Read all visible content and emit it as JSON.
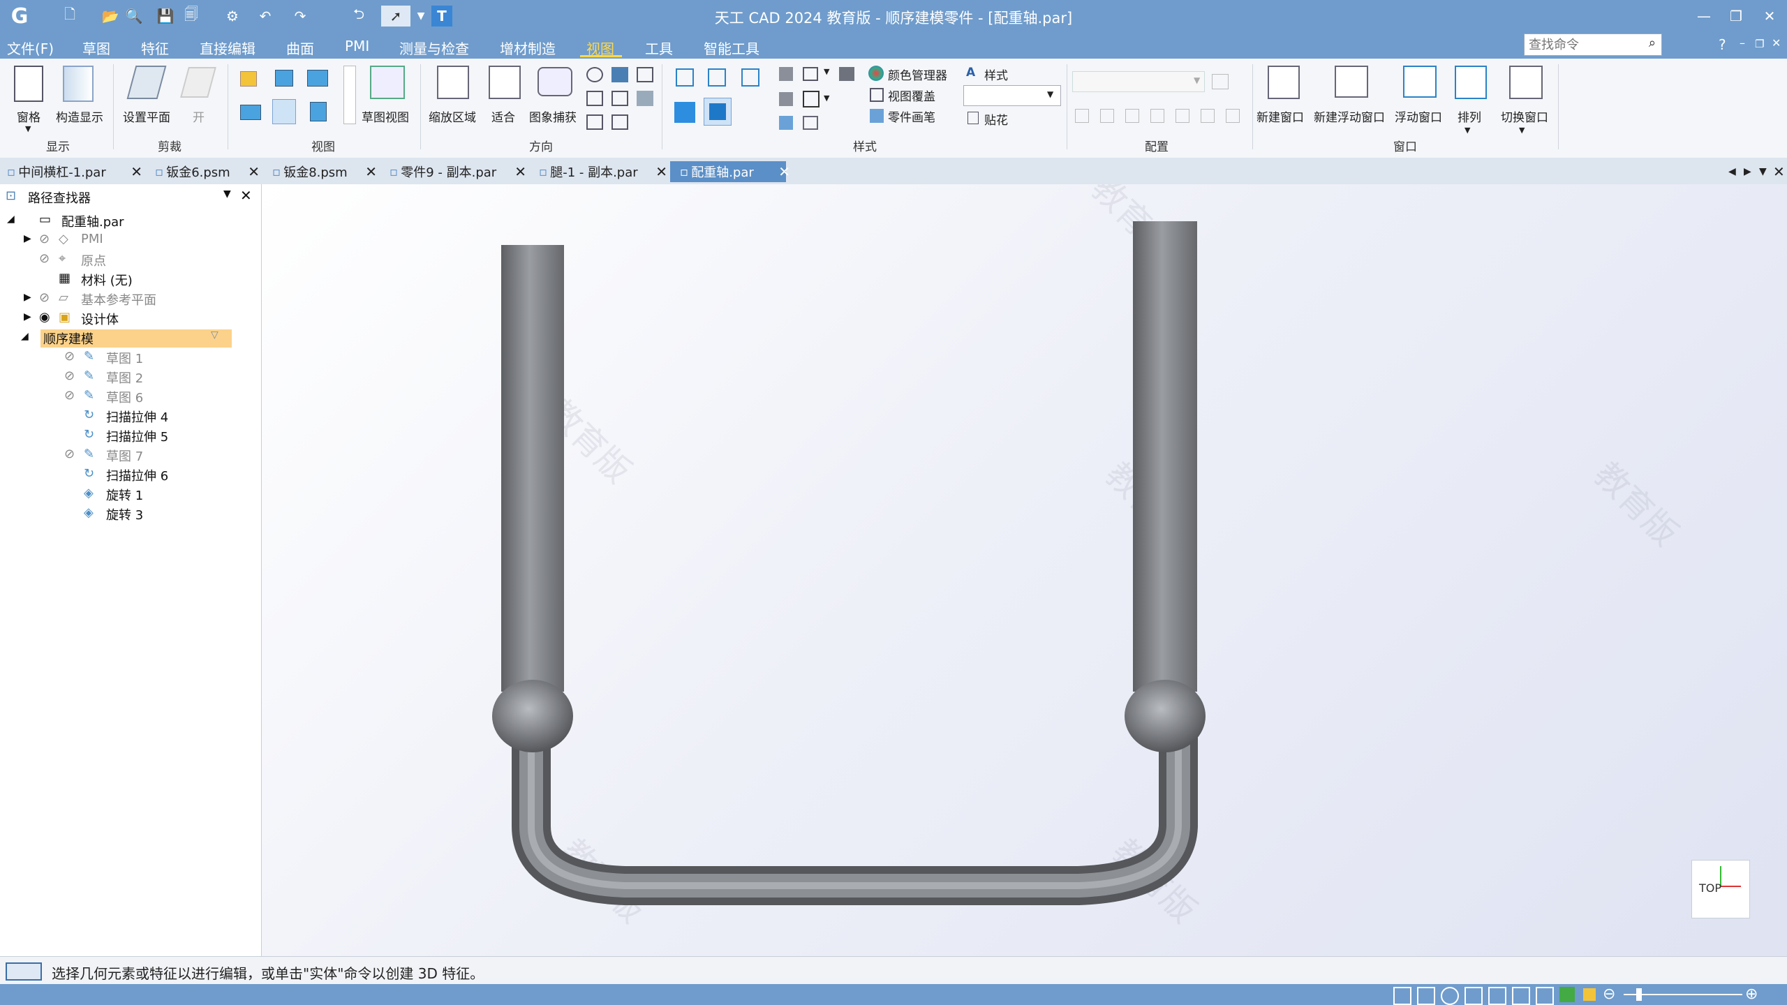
{
  "window": {
    "title": "天工 CAD 2024 教育版 - 顺序建模零件 - [配重轴.par]"
  },
  "menu": {
    "items": [
      "文件(F)",
      "草图",
      "特征",
      "直接编辑",
      "曲面",
      "PMI",
      "测量与检查",
      "增材制造",
      "视图",
      "工具",
      "智能工具"
    ],
    "active": "视图"
  },
  "search": {
    "placeholder": "查找命令"
  },
  "ribbon": {
    "labels": {
      "pane": "窗格",
      "construct": "构造显示",
      "setplane": "设置平面",
      "open": "开",
      "sketchview": "草图视图",
      "zoomarea": "缩放区域",
      "fit": "适合",
      "capture": "图象捕获",
      "colormgr": "颜色管理器",
      "viewoverlay": "视图覆盖",
      "partpen": "零件画笔",
      "style": "样式",
      "decal": "贴花",
      "newwin": "新建窗口",
      "newfloat": "新建浮动窗口",
      "floatwin": "浮动窗口",
      "arrange": "排列",
      "switchwin": "切换窗口"
    },
    "groups": {
      "display": "显示",
      "clip": "剪裁",
      "view": "视图",
      "orient": "方向",
      "style": "样式",
      "config": "配置",
      "window": "窗口"
    }
  },
  "tabs": [
    "中间横杠-1.par",
    "钣金6.psm",
    "钣金8.psm",
    "零件9 - 副本.par",
    "腿-1 - 副本.par",
    "配重轴.par"
  ],
  "active_tab": "配重轴.par",
  "pathfinder": {
    "title": "路径查找器",
    "root": "配重轴.par",
    "items": [
      "PMI",
      "原点",
      "材料 (无)",
      "基本参考平面",
      "设计体",
      "顺序建模"
    ],
    "features": [
      "草图 1",
      "草图 2",
      "草图 6",
      "扫描拉伸 4",
      "扫描拉伸 5",
      "草图 7",
      "扫描拉伸 6",
      "旋转 1",
      "旋转 3"
    ]
  },
  "viewport": {
    "watermark": "教育版",
    "orientation": "TOP"
  },
  "status": {
    "message": "选择几何元素或特征以进行编辑，或单击\"实体\"命令以创建 3D 特征。"
  }
}
